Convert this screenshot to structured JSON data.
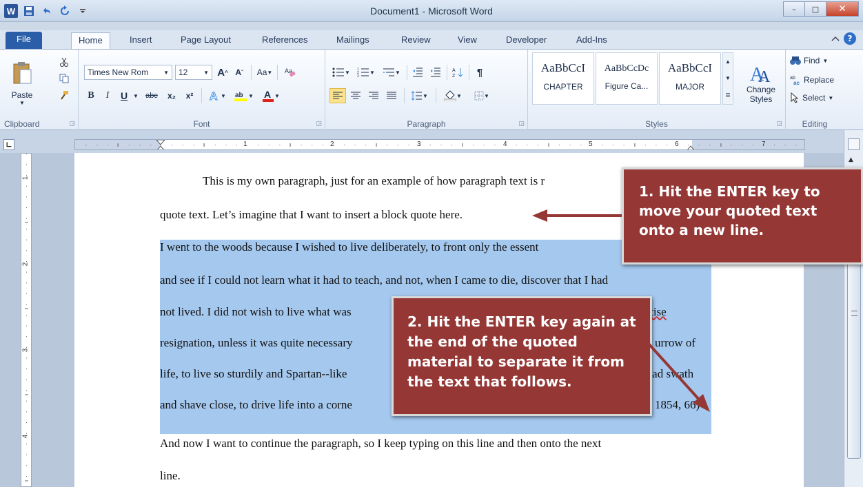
{
  "window": {
    "title": "Document1 - Microsoft Word",
    "app_icon": "W",
    "minimize": "–",
    "maximize": "□",
    "close": "✕"
  },
  "quick_access": {
    "save_icon": "save-icon",
    "undo_icon": "undo-icon",
    "redo_icon": "redo-icon"
  },
  "tabs": [
    "File",
    "Home",
    "Insert",
    "Page Layout",
    "References",
    "Mailings",
    "Review",
    "View",
    "Developer",
    "Add-Ins"
  ],
  "ribbon": {
    "clipboard": {
      "label": "Clipboard",
      "paste": "Paste"
    },
    "font": {
      "label": "Font",
      "family": "Times New Rom",
      "size": "12",
      "change_case": "Aa",
      "bold": "B",
      "italic": "I",
      "underline": "U",
      "strike": "abc",
      "subscript": "x₂",
      "superscript": "x²"
    },
    "paragraph": {
      "label": "Paragraph",
      "show_marks": "¶"
    },
    "styles": {
      "label": "Styles",
      "items": [
        {
          "sample": "AaBbCcI",
          "name": "CHAPTER"
        },
        {
          "sample": "AaBbCcDc",
          "name": "Figure Ca..."
        },
        {
          "sample": "AaBbCcI",
          "name": "MAJOR"
        }
      ],
      "change_styles": "Change Styles"
    },
    "editing": {
      "label": "Editing",
      "find": "Find",
      "replace": "Replace",
      "select": "Select"
    }
  },
  "ruler": {
    "h_numbers": [
      "1",
      "2",
      "3",
      "4",
      "5",
      "6",
      "7"
    ],
    "v_numbers": [
      "1",
      "2",
      "3",
      "4"
    ]
  },
  "document": {
    "lines": [
      "This is my own paragraph, just for an example of how paragraph text is r",
      "quote text. Let’s imagine that I want to insert a block quote here.",
      "I went to the woods because I wished to live deliberately, to front only the essent",
      "and see if I could not learn what it had to teach, and not, when I came to die, discover that I had",
      "not lived. I did not wish to live what was",
      "actise",
      "resignation, unless it was quite necessary",
      "urrow of",
      "life, to live so sturdily and Spartan--like",
      "road swath",
      "and shave close, to drive life into a corne",
      "1854, 66)",
      "And now I want to continue the paragraph, so I keep typing on this line and then onto the next",
      "line."
    ]
  },
  "callouts": {
    "c1": "1. Hit the ENTER key to move your quoted text onto a new line.",
    "c2": "2. Hit the ENTER key again at the end of the quoted material to separate it from the text that follows."
  },
  "colors": {
    "callout": "#953735",
    "selection": "#a5c8ee",
    "file_tab": "#2a5ea8"
  }
}
